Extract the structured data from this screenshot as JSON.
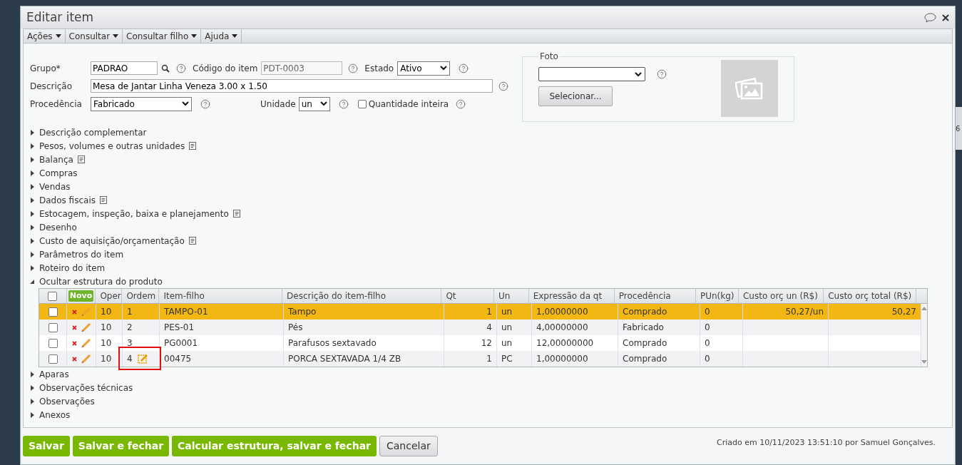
{
  "background": {
    "badge": "6"
  },
  "window": {
    "title": "Editar item"
  },
  "menu": [
    {
      "label": "Ações"
    },
    {
      "label": "Consultar"
    },
    {
      "label": "Consultar filho"
    },
    {
      "label": "Ajuda"
    }
  ],
  "form": {
    "grupo": {
      "label": "Grupo*",
      "value": "PADRAO"
    },
    "codigo": {
      "label": "Código do item",
      "value": "PDT-0003"
    },
    "estado": {
      "label": "Estado",
      "value": "Ativo"
    },
    "descricao": {
      "label": "Descrição",
      "value": "Mesa de Jantar Linha Veneza 3.00 x 1.50"
    },
    "procedencia": {
      "label": "Procedência",
      "value": "Fabricado"
    },
    "unidade": {
      "label": "Unidade",
      "value": "un"
    },
    "quantidade_inteira": {
      "label": "Quantidade inteira",
      "checked": false
    }
  },
  "foto": {
    "legend": "Foto",
    "button": "Selecionar..."
  },
  "sections_before": [
    {
      "label": "Descrição complementar",
      "note": false,
      "expanded": false
    },
    {
      "label": "Pesos, volumes e outras unidades",
      "note": true,
      "expanded": false
    },
    {
      "label": "Balança",
      "note": true,
      "expanded": false
    },
    {
      "label": "Compras",
      "note": false,
      "expanded": false
    },
    {
      "label": "Vendas",
      "note": false,
      "expanded": false
    },
    {
      "label": "Dados fiscais",
      "note": true,
      "expanded": false
    },
    {
      "label": "Estocagem, inspeção, baixa e planejamento",
      "note": true,
      "expanded": false
    },
    {
      "label": "Desenho",
      "note": false,
      "expanded": false
    },
    {
      "label": "Custo de aquisição/orçamentação",
      "note": true,
      "expanded": false
    },
    {
      "label": "Parâmetros do item",
      "note": false,
      "expanded": false
    },
    {
      "label": "Roteiro do item",
      "note": false,
      "expanded": false
    },
    {
      "label": "Ocultar estrutura do produto",
      "note": false,
      "expanded": true
    }
  ],
  "table": {
    "select_all_checked": false,
    "new_button": "Novo",
    "columns": [
      "Oper",
      "Ordem",
      "Item-filho",
      "Descrição do item-filho",
      "Qt",
      "Un",
      "Expressão da qt",
      "Procedência",
      "PUn(kg)",
      "Custo orç un (R$)",
      "Custo orç total (R$)"
    ],
    "rows": [
      {
        "selected": true,
        "checked": false,
        "highlighted": false,
        "cells": [
          "10",
          "1",
          "TAMPO-01",
          "Tampo",
          "1",
          "un",
          "1,00000000",
          "Comprado",
          "0",
          "50,27/un",
          "50,27"
        ]
      },
      {
        "selected": false,
        "checked": false,
        "highlighted": false,
        "cells": [
          "10",
          "2",
          "PES-01",
          "Pés",
          "4",
          "un",
          "4,00000000",
          "Fabricado",
          "0",
          "",
          ""
        ]
      },
      {
        "selected": false,
        "checked": false,
        "highlighted": false,
        "cells": [
          "10",
          "3",
          "PG0001",
          "Parafusos sextavado",
          "12",
          "un",
          "12,00000000",
          "Comprado",
          "0",
          "",
          ""
        ]
      },
      {
        "selected": false,
        "checked": false,
        "highlighted": true,
        "cells": [
          "10",
          "4",
          "00475",
          "PORCA SEXTAVADA 1/4 ZB",
          "1",
          "PC",
          "1,00000000",
          "Comprado",
          "0",
          "",
          ""
        ]
      }
    ]
  },
  "sections_after": [
    {
      "label": "Aparas",
      "note": false,
      "expanded": false
    },
    {
      "label": "Observações técnicas",
      "note": false,
      "expanded": false
    },
    {
      "label": "Observações",
      "note": false,
      "expanded": false
    },
    {
      "label": "Anexos",
      "note": false,
      "expanded": false
    }
  ],
  "footer": {
    "buttons": [
      {
        "label": "Salvar",
        "kind": "primary"
      },
      {
        "label": "Salvar e fechar",
        "kind": "primary"
      },
      {
        "label": "Calcular estrutura, salvar e fechar",
        "kind": "primary"
      },
      {
        "label": "Cancelar",
        "kind": "secondary"
      }
    ],
    "created": "Criado em 10/11/2023 13:51:10 por Samuel Gonçalves."
  }
}
